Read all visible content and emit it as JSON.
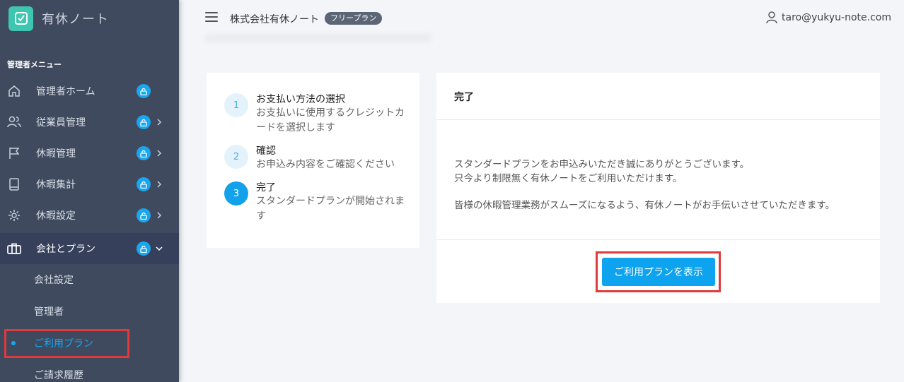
{
  "app": {
    "name": "有休ノート"
  },
  "sidebar": {
    "section_title": "管理者メニュー",
    "items": [
      {
        "label": "管理者ホーム",
        "icon": "home-icon",
        "chevron": ""
      },
      {
        "label": "従業員管理",
        "icon": "users-icon",
        "chevron": "right"
      },
      {
        "label": "休暇管理",
        "icon": "flag-icon",
        "chevron": "right"
      },
      {
        "label": "休暇集計",
        "icon": "book-icon",
        "chevron": "right"
      },
      {
        "label": "休暇設定",
        "icon": "gear-icon",
        "chevron": "right"
      },
      {
        "label": "会社とプラン",
        "icon": "briefcase-icon",
        "chevron": "down"
      }
    ],
    "sub_items": [
      {
        "label": "会社設定"
      },
      {
        "label": "管理者"
      },
      {
        "label": "ご利用プラン"
      },
      {
        "label": "ご請求履歴"
      }
    ]
  },
  "header": {
    "company": "株式会社有休ノート",
    "plan_badge": "フリープラン",
    "user_email": "taro@yukyu-note.com"
  },
  "steps": [
    {
      "number": "1",
      "title": "お支払い方法の選択",
      "desc": "お支払いに使用するクレジットカードを選択します"
    },
    {
      "number": "2",
      "title": "確認",
      "desc": "お申込み内容をご確認ください"
    },
    {
      "number": "3",
      "title": "完了",
      "desc": "スタンダードプランが開始されます"
    }
  ],
  "complete": {
    "title": "完了",
    "message_line1": "スタンダードプランをお申込みいただき誠にありがとうございます。",
    "message_line2": "只今より制限無く有休ノートをご利用いただけます。",
    "message_line3": "皆様の休暇管理業務がスムーズになるよう、有休ノートがお手伝いさせていただきます。",
    "button_label": "ご利用プランを表示"
  },
  "colors": {
    "sidebar_bg": "#3f4a5f",
    "accent": "#0ea3ee",
    "brand": "#3ec6b0",
    "highlight": "#e03a3a"
  }
}
